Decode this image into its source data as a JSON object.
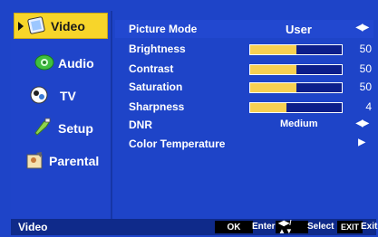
{
  "sidebar": {
    "items": [
      {
        "label": "Video",
        "icon": "tv-screen-icon"
      },
      {
        "label": "Audio",
        "icon": "speaker-icon"
      },
      {
        "label": "TV",
        "icon": "antenna-icon"
      },
      {
        "label": "Setup",
        "icon": "setup-icon"
      },
      {
        "label": "Parental",
        "icon": "parental-icon"
      }
    ]
  },
  "settings": {
    "picture_mode": {
      "label": "Picture Mode",
      "value": "User"
    },
    "brightness": {
      "label": "Brightness",
      "value": "50",
      "level": 0.5
    },
    "contrast": {
      "label": "Contrast",
      "value": "50",
      "level": 0.5
    },
    "saturation": {
      "label": "Saturation",
      "value": "50",
      "level": 0.5
    },
    "sharpness": {
      "label": "Sharpness",
      "value": "4",
      "level": 0.4
    },
    "dnr": {
      "label": "DNR",
      "value": "Medium"
    },
    "color_temperature": {
      "label": "Color Temperature"
    }
  },
  "footer": {
    "title": "Video",
    "ok_key": "OK",
    "enter_hint": "Enter",
    "select_hint": "Select",
    "exit_key": "EXIT",
    "exit_hint": "Exit"
  },
  "colors": {
    "background": "#1e44c8",
    "highlight": "#f7d52a",
    "bar_fill": "#f7d052",
    "bar_track": "#0c1e8a"
  }
}
